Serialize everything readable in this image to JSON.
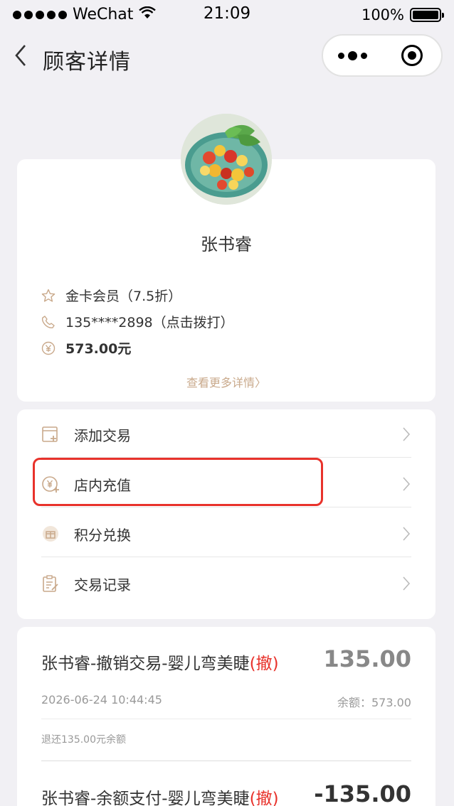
{
  "status_bar": {
    "carrier": "WeChat",
    "time": "21:09",
    "battery": "100%"
  },
  "nav": {
    "title": "顾客详情"
  },
  "profile": {
    "name": "张书睿",
    "membership": "金卡会员（7.5折）",
    "phone": "135****2898（点击拨打）",
    "balance": "573.00元",
    "more_link": "查看更多详情〉"
  },
  "menu": {
    "items": [
      {
        "label": "添加交易",
        "icon": "add-transaction-icon"
      },
      {
        "label": "店内充值",
        "icon": "recharge-icon"
      },
      {
        "label": "积分兑换",
        "icon": "gift-icon"
      },
      {
        "label": "交易记录",
        "icon": "records-icon"
      }
    ]
  },
  "transactions": [
    {
      "title": "张书睿-撤销交易-婴儿弯美睫",
      "tag": "(撤)",
      "amount": "135.00",
      "date": "2026-06-24 10:44:45",
      "balance": "余额：573.00",
      "note": "退还135.00元余额"
    },
    {
      "title": "张书睿-余额支付-婴儿弯美睫",
      "tag": "(撤)",
      "amount": "-135.00"
    }
  ],
  "colors": {
    "accent": "#c9a98b",
    "highlight": "#e8322b",
    "tag": "#e8322b"
  }
}
